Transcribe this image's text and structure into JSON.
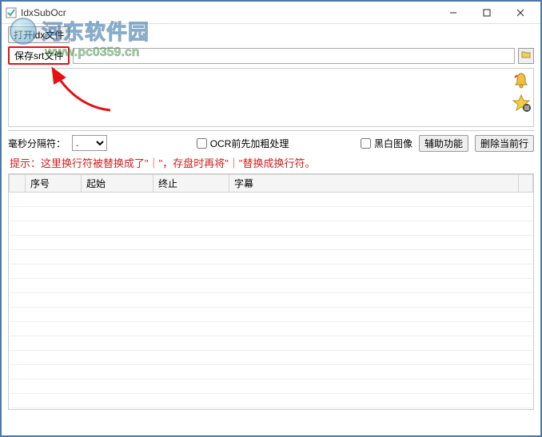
{
  "window": {
    "title": "IdxSubOcr"
  },
  "toolbar": {
    "open_idx_label": "打开idx文件",
    "save_srt_label": "保存srt文件"
  },
  "options": {
    "separator_label": "毫秒分隔符：",
    "separator_value": ".",
    "ocr_bold_label": "OCR前先加粗处理",
    "bw_image_label": "黑白图像",
    "assist_label": "辅助功能",
    "delete_row_label": "删除当前行"
  },
  "hint": "提示：这里换行符被替换成了\"｜\"，存盘时再将\"｜\"替换成换行符。",
  "table": {
    "headers": {
      "num": "序号",
      "start": "起始",
      "end": "终止",
      "subtitle": "字幕"
    }
  },
  "watermark": {
    "brand": "河东软件园",
    "url": "www.pc0359.cn"
  },
  "colors": {
    "accent_red": "#e31114",
    "hint_red": "#d02020"
  }
}
